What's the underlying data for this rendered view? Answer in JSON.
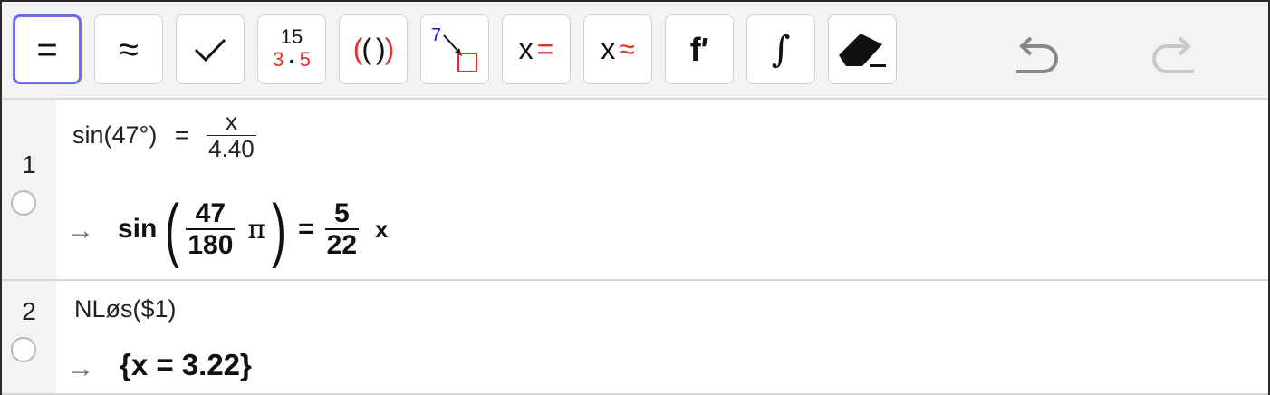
{
  "toolbar": {
    "buttons": [
      {
        "name": "evaluate-button",
        "label": "=",
        "active": true
      },
      {
        "name": "numeric-button",
        "label": "≈"
      },
      {
        "name": "keep-input-button",
        "label": "✓"
      },
      {
        "name": "factor-button",
        "top": "15",
        "bottom_left": "3",
        "dot": "•",
        "bottom_right": "5"
      },
      {
        "name": "expand-button",
        "label": "(( ))"
      },
      {
        "name": "substitute-button",
        "top": "7"
      },
      {
        "name": "solve-button",
        "var": "x",
        "sym": "="
      },
      {
        "name": "solve-numerically-button",
        "var": "x",
        "sym": "≈"
      },
      {
        "name": "derivative-button",
        "label": "f′"
      },
      {
        "name": "integral-button",
        "label": "∫"
      },
      {
        "name": "delete-button",
        "icon": "eraser-icon"
      }
    ],
    "undo_icon": "undo-icon",
    "redo_icon": "redo-icon"
  },
  "rows": [
    {
      "number": "1",
      "input": {
        "lhs": "sin(47°)",
        "eq": "=",
        "num": "x",
        "den": "4.40"
      },
      "arrow": "→",
      "output": {
        "func": "sin",
        "num": "47",
        "den": "180",
        "pi": "π",
        "eq": "=",
        "rnum": "5",
        "rden": "22",
        "var": "x"
      }
    },
    {
      "number": "2",
      "input": {
        "text": "NLøs($1)"
      },
      "arrow": "→",
      "output": {
        "text": "{x = 3.22}"
      }
    }
  ],
  "colors": {
    "accent": "#6d6dea",
    "red": "#e0312c",
    "blue": "#1919d8",
    "gutter": "#f3f3f3"
  }
}
